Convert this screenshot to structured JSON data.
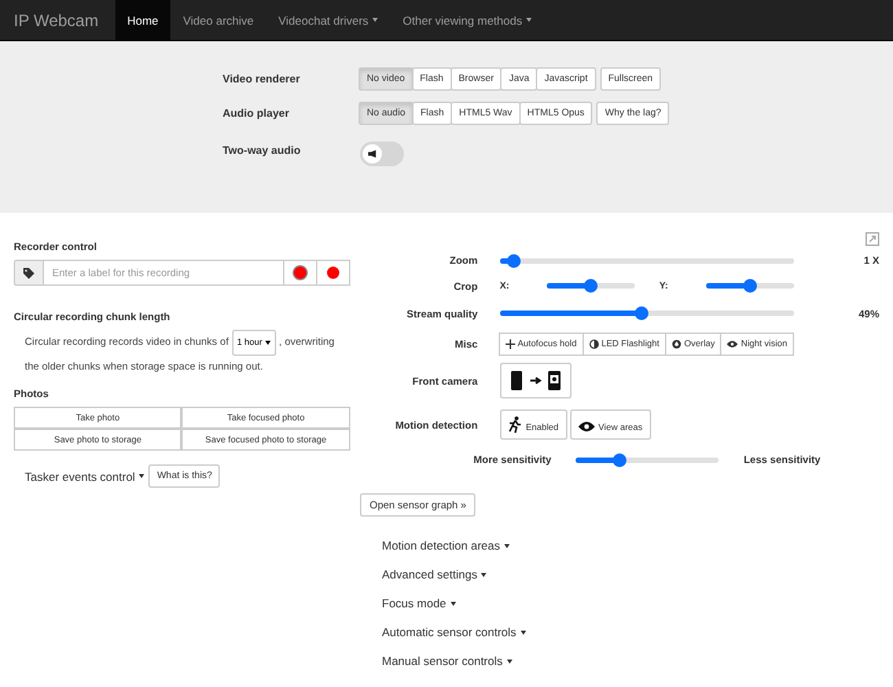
{
  "navbar": {
    "brand": "IP Webcam",
    "items": [
      {
        "label": "Home",
        "selected": true,
        "dropdown": false
      },
      {
        "label": "Video archive",
        "selected": false,
        "dropdown": false
      },
      {
        "label": "Videochat drivers",
        "selected": false,
        "dropdown": true
      },
      {
        "label": "Other viewing methods",
        "selected": false,
        "dropdown": true
      }
    ]
  },
  "player_settings": {
    "rows": [
      {
        "label": "Video renderer",
        "kind": "buttons",
        "options": [
          {
            "label": "No video",
            "selected": true
          },
          {
            "label": "Flash",
            "selected": false
          },
          {
            "label": "Browser",
            "selected": false
          },
          {
            "label": "Java",
            "selected": false
          },
          {
            "label": "Javascript",
            "selected": false
          }
        ],
        "extra": "Fullscreen"
      },
      {
        "label": "Audio player",
        "kind": "buttons",
        "options": [
          {
            "label": "No audio",
            "selected": true
          },
          {
            "label": "Flash",
            "selected": false
          },
          {
            "label": "HTML5 Wav",
            "selected": false
          },
          {
            "label": "HTML5 Opus",
            "selected": false
          }
        ],
        "extra": "Why the lag?"
      },
      {
        "label": "Two-way audio",
        "kind": "toggle",
        "on": false
      }
    ]
  },
  "recorder": {
    "title": "Recorder control",
    "placeholder": "Enter a label for this recording"
  },
  "chunk": {
    "title": "Circular recording chunk length",
    "text_before": "Circular recording records video in chunks of",
    "value": "1 hour",
    "text_after": ", overwriting the older chunks when storage space is running out."
  },
  "photos": {
    "title": "Photos",
    "buttons": [
      "Take photo",
      "Take focused photo",
      "Save photo to storage",
      "Save focused photo to storage"
    ]
  },
  "tasker": {
    "label": "Tasker events control",
    "help": "What is this?"
  },
  "controls": {
    "zoom": {
      "label": "Zoom",
      "level": 0.05,
      "reading": "1 X"
    },
    "crop": {
      "label": "Crop",
      "axes": [
        {
          "label": "X:",
          "level": 0.5
        },
        {
          "label": "Y:",
          "level": 0.5
        }
      ]
    },
    "quality": {
      "label": "Stream quality",
      "level": 0.48,
      "reading": "49%"
    },
    "misc": {
      "label": "Misc",
      "buttons": [
        {
          "label": "Autofocus hold",
          "kind": "focus"
        },
        {
          "label": "LED Flashlight",
          "kind": "flash"
        },
        {
          "label": "Overlay",
          "kind": "overlay"
        },
        {
          "label": "Night vision",
          "kind": "night"
        }
      ]
    },
    "front_camera": {
      "label": "Front camera"
    },
    "motion": {
      "label": "Motion detection",
      "enabled": "Enabled",
      "view": "View areas"
    },
    "sensitivity": {
      "more": "More sensitivity",
      "less": "Less sensitivity",
      "level": 0.3
    }
  },
  "sensor_graph": "Open sensor graph »",
  "sections": [
    "Motion detection areas",
    "Advanced settings",
    "Focus mode",
    "Automatic sensor controls",
    "Manual sensor controls"
  ]
}
